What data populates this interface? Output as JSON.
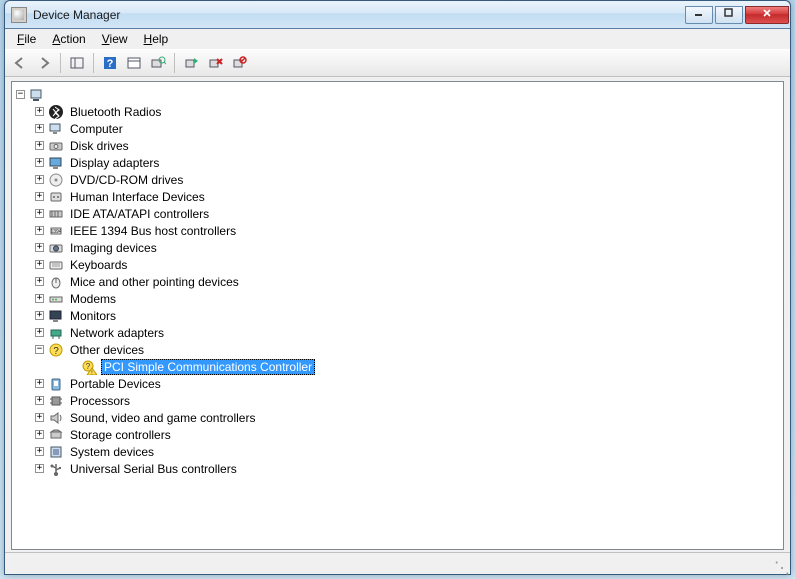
{
  "title": "Device Manager",
  "menu": {
    "file": "File",
    "action": "Action",
    "view": "View",
    "help": "Help"
  },
  "toolbar": [
    "back",
    "forward",
    "|",
    "show-hide",
    "|",
    "help",
    "|",
    "properties",
    "scan",
    "|",
    "update-driver",
    "uninstall",
    "disable"
  ],
  "root": {
    "label": ""
  },
  "categories": [
    {
      "icon": "bluetooth",
      "label": "Bluetooth Radios",
      "expanded": false
    },
    {
      "icon": "computer",
      "label": "Computer",
      "expanded": false
    },
    {
      "icon": "disk",
      "label": "Disk drives",
      "expanded": false
    },
    {
      "icon": "display",
      "label": "Display adapters",
      "expanded": false
    },
    {
      "icon": "dvd",
      "label": "DVD/CD-ROM drives",
      "expanded": false
    },
    {
      "icon": "hid",
      "label": "Human Interface Devices",
      "expanded": false
    },
    {
      "icon": "ide",
      "label": "IDE ATA/ATAPI controllers",
      "expanded": false
    },
    {
      "icon": "ieee1394",
      "label": "IEEE 1394 Bus host controllers",
      "expanded": false
    },
    {
      "icon": "imaging",
      "label": "Imaging devices",
      "expanded": false
    },
    {
      "icon": "keyboard",
      "label": "Keyboards",
      "expanded": false
    },
    {
      "icon": "mouse",
      "label": "Mice and other pointing devices",
      "expanded": false
    },
    {
      "icon": "modem",
      "label": "Modems",
      "expanded": false
    },
    {
      "icon": "monitor",
      "label": "Monitors",
      "expanded": false
    },
    {
      "icon": "network",
      "label": "Network adapters",
      "expanded": false
    },
    {
      "icon": "other",
      "label": "Other devices",
      "expanded": true,
      "children": [
        {
          "icon": "unknown-warn",
          "label": "PCI Simple Communications Controller",
          "selected": true
        }
      ]
    },
    {
      "icon": "portable",
      "label": "Portable Devices",
      "expanded": false
    },
    {
      "icon": "processor",
      "label": "Processors",
      "expanded": false
    },
    {
      "icon": "sound",
      "label": "Sound, video and game controllers",
      "expanded": false
    },
    {
      "icon": "storage",
      "label": "Storage controllers",
      "expanded": false
    },
    {
      "icon": "system",
      "label": "System devices",
      "expanded": false
    },
    {
      "icon": "usb",
      "label": "Universal Serial Bus controllers",
      "expanded": false
    }
  ]
}
